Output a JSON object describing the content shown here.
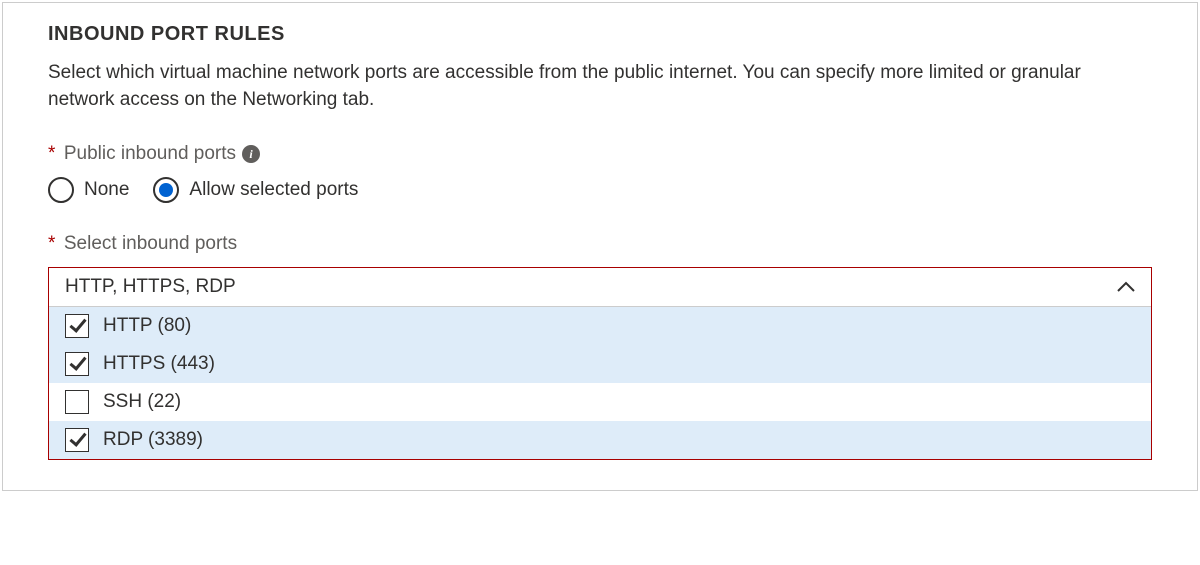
{
  "section": {
    "title": "INBOUND PORT RULES",
    "description": "Select which virtual machine network ports are accessible from the public internet. You can specify more limited or granular network access on the Networking tab."
  },
  "publicInboundPorts": {
    "label": "Public inbound ports",
    "options": {
      "none": "None",
      "allow": "Allow selected ports"
    },
    "selected": "allow"
  },
  "selectInboundPorts": {
    "label": "Select inbound ports",
    "value": "HTTP, HTTPS, RDP",
    "options": [
      {
        "label": "HTTP (80)",
        "checked": true
      },
      {
        "label": "HTTPS (443)",
        "checked": true
      },
      {
        "label": "SSH (22)",
        "checked": false
      },
      {
        "label": "RDP (3389)",
        "checked": true
      }
    ]
  }
}
